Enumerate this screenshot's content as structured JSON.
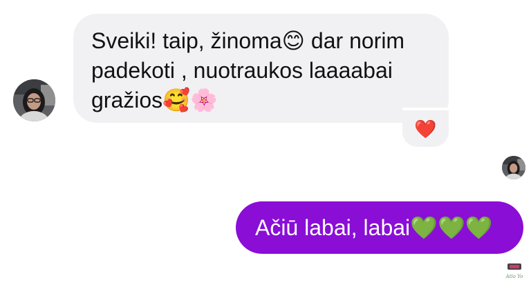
{
  "incoming": {
    "text": "Sveiki! taip, žinoma😊 dar norim\npadekoti , nuotraukos laaaabai\ngražios🥰🌸",
    "reaction": "❤️"
  },
  "outgoing": {
    "text": "Ačiū labai, labai💚💚💚"
  },
  "watermark": {
    "text": "Atlo Yo"
  },
  "colors": {
    "incoming_bubble": "#f1f1f3",
    "outgoing_bubble": "#8a0ed6",
    "reaction_heart": "#e8112d"
  },
  "icons": {
    "incoming_avatar": "user-avatar",
    "seen_avatar": "seen-indicator-avatar",
    "watermark": "logo-watermark"
  }
}
